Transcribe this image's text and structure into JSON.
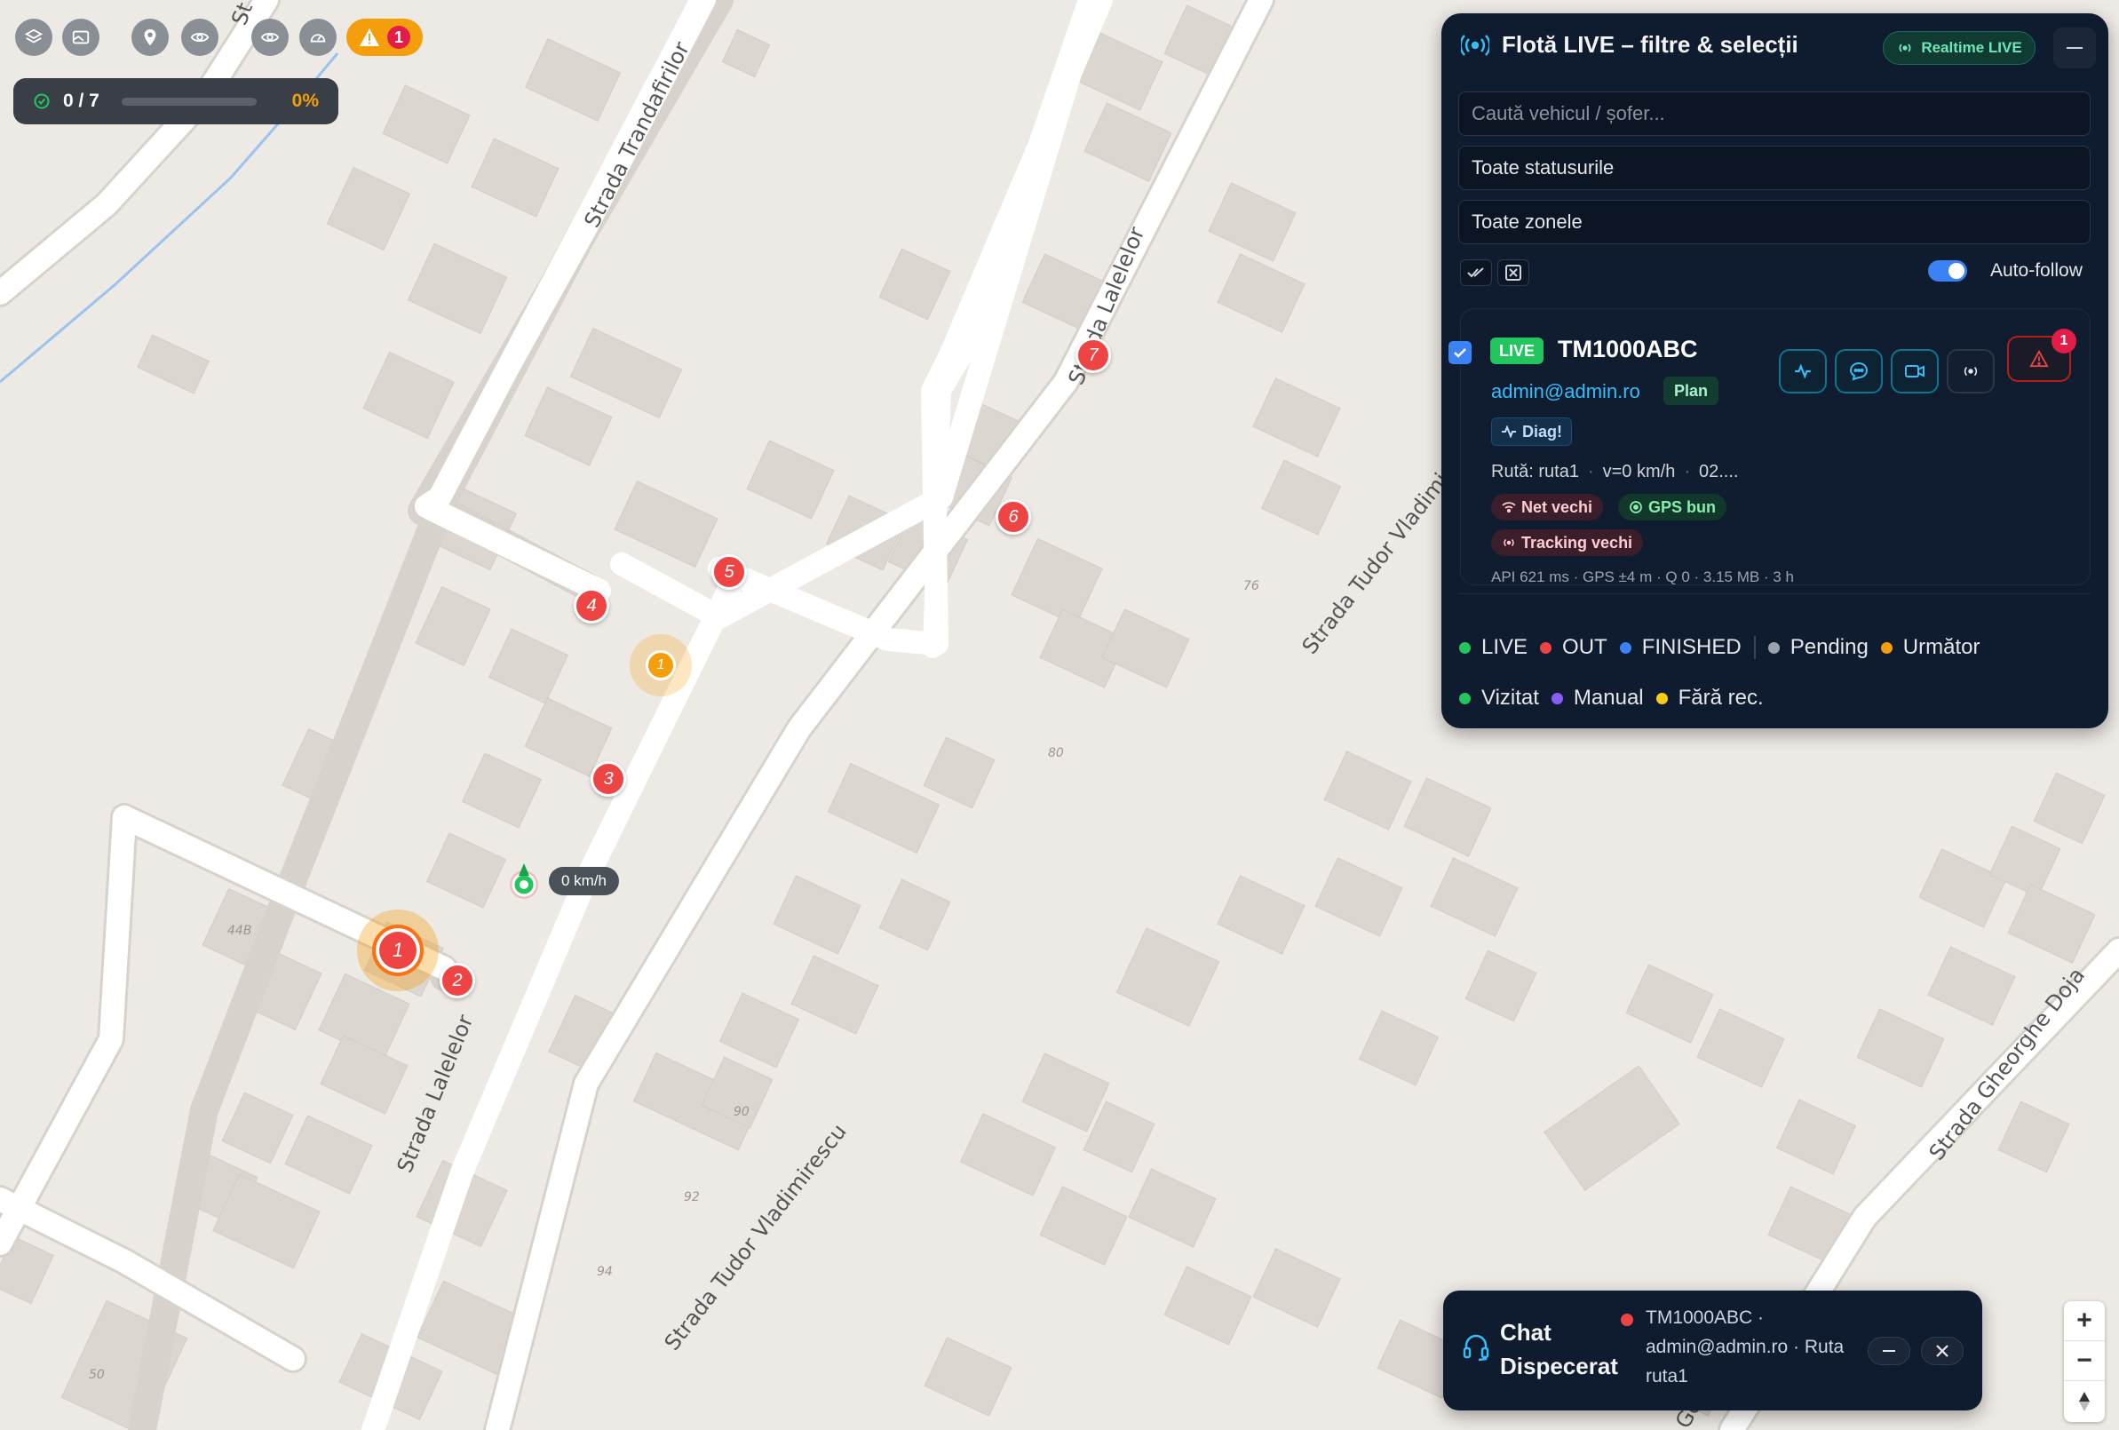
{
  "toolbar": {
    "alert_count": "1"
  },
  "progress": {
    "fraction_label": "0 / 7",
    "percent_label": "0%",
    "value": 0
  },
  "map": {
    "streets": [
      "Strada Trandafirilor",
      "Strada Lalelelor",
      "Strada Lalelelor",
      "Strada Tudor Vladimirescu",
      "Strada Tudor Vladimi",
      "Strada Gheorghe Doja",
      "St",
      "Georg"
    ],
    "house_numbers": [
      "44B",
      "76",
      "80",
      "90",
      "92",
      "94",
      "50"
    ],
    "stops": [
      "1",
      "2",
      "3",
      "4",
      "5",
      "6",
      "7"
    ],
    "next_stop": "1",
    "vehicle_speed": "0 km/h"
  },
  "panel": {
    "title": "Flotă LIVE – filtre & selecții",
    "realtime_label": "Realtime LIVE",
    "search_placeholder": "Caută vehicul / șofer...",
    "status_filter": "Toate statusurile",
    "zone_filter": "Toate zonele",
    "autofollow_label": "Auto-follow",
    "vehicle": {
      "live_badge": "LIVE",
      "plate": "TM1000ABC",
      "driver": "admin@admin.ro",
      "plan_badge": "Plan",
      "diag_badge": "Diag!",
      "route": "Rută: ruta1",
      "speed": "v=0 km/h",
      "time": "02....",
      "chips": [
        "Net vechi",
        "GPS bun",
        "Tracking vechi"
      ],
      "stats": "API 621 ms · GPS ±4 m · Q 0 · 3.15 MB · 3 h",
      "alert_count": "1"
    },
    "legend_row1": [
      "LIVE",
      "OUT",
      "FINISHED",
      "Pending",
      "Următor"
    ],
    "legend_row2": [
      "Vizitat",
      "Manual",
      "Fără rec."
    ]
  },
  "chat": {
    "title_line1": "Chat",
    "title_line2": "Dispecerat",
    "info": "TM1000ABC · admin@admin.ro · Ruta ruta1"
  },
  "colors": {
    "panel_bg": "#0f1b2e",
    "stop_red": "#ef4444",
    "next_orange": "#f59e0b",
    "live_green": "#22c55e",
    "accent_blue": "#3b82f6"
  }
}
